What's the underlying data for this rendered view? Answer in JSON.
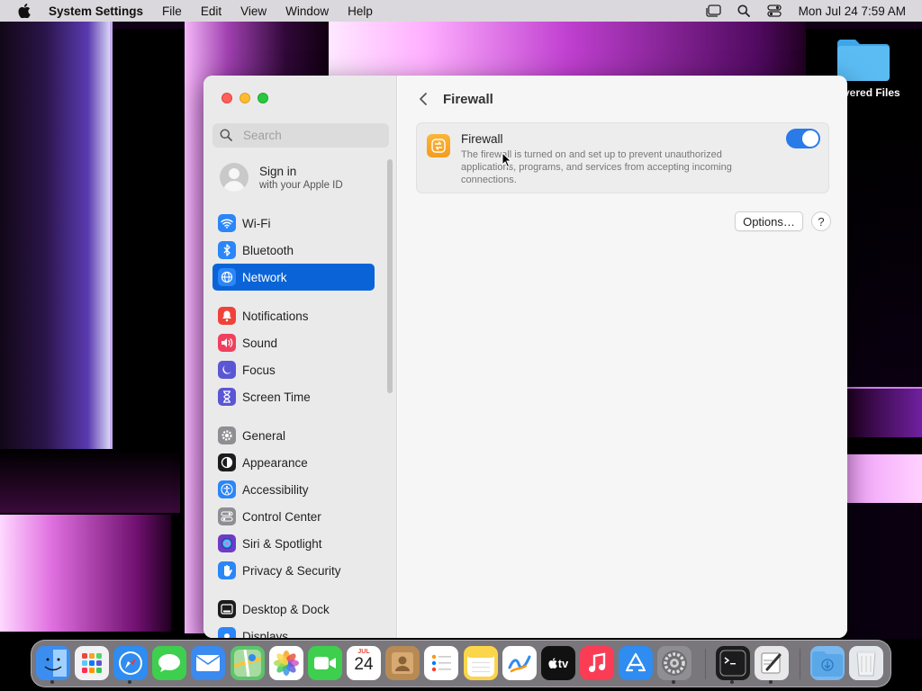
{
  "menubar": {
    "app_name": "System Settings",
    "menus": [
      "File",
      "Edit",
      "View",
      "Window",
      "Help"
    ],
    "clock": "Mon Jul 24  7:59 AM"
  },
  "desktop": {
    "folder_label": "vered Files"
  },
  "sidebar": {
    "search_placeholder": "Search",
    "signin_title": "Sign in",
    "signin_subtitle": "with your Apple ID",
    "items": [
      {
        "label": "Wi-Fi",
        "icon": "wifi-icon",
        "color": "#2b86f7"
      },
      {
        "label": "Bluetooth",
        "icon": "bluetooth-icon",
        "color": "#2b86f7"
      },
      {
        "label": "Network",
        "icon": "globe-icon",
        "color": "#2b86f7",
        "selected": true
      },
      {
        "label": "Notifications",
        "icon": "bell-icon",
        "color": "#f0423a"
      },
      {
        "label": "Sound",
        "icon": "speaker-icon",
        "color": "#f0405e"
      },
      {
        "label": "Focus",
        "icon": "moon-icon",
        "color": "#5a56d4"
      },
      {
        "label": "Screen Time",
        "icon": "hourglass-icon",
        "color": "#5a56d4"
      },
      {
        "label": "General",
        "icon": "gear-icon",
        "color": "#8e8e93"
      },
      {
        "label": "Appearance",
        "icon": "appearance-icon",
        "color": "#1c1c1e"
      },
      {
        "label": "Accessibility",
        "icon": "accessibility-icon",
        "color": "#2b86f7"
      },
      {
        "label": "Control Center",
        "icon": "control-center-icon",
        "color": "#8e8e93"
      },
      {
        "label": "Siri & Spotlight",
        "icon": "siri-icon",
        "color": "#6b3cc8"
      },
      {
        "label": "Privacy & Security",
        "icon": "hand-icon",
        "color": "#2b86f7"
      },
      {
        "label": "Desktop & Dock",
        "icon": "dock-icon",
        "color": "#1c1c1e"
      },
      {
        "label": "Displays",
        "icon": "sun-icon",
        "color": "#2b86f7"
      }
    ]
  },
  "content": {
    "title": "Firewall",
    "card": {
      "title": "Firewall",
      "description": "The firewall is turned on and set up to prevent unauthorized applications, programs, and services from accepting incoming connections.",
      "toggle_on": true
    },
    "options_label": "Options…",
    "help_label": "?"
  },
  "dock": {
    "calendar_month": "JUL",
    "calendar_day": "24",
    "tv_label": "tv",
    "items": [
      {
        "name": "finder-icon",
        "color": "#3b8ef0"
      },
      {
        "name": "launchpad-icon",
        "color": "#f2f2f4"
      },
      {
        "name": "safari-icon",
        "color": "#2f8cf0"
      },
      {
        "name": "messages-icon",
        "color": "#3ecf4e"
      },
      {
        "name": "mail-icon",
        "color": "#3a8af0"
      },
      {
        "name": "maps-icon",
        "color": "#5cc46c"
      },
      {
        "name": "photos-icon",
        "color": "#ffffff"
      },
      {
        "name": "facetime-icon",
        "color": "#3ecf4e"
      },
      {
        "name": "calendar-icon",
        "color": "#ffffff"
      },
      {
        "name": "contacts-icon",
        "color": "#b88a54"
      },
      {
        "name": "reminders-icon",
        "color": "#ffffff"
      },
      {
        "name": "notes-icon",
        "color": "#fbd54a"
      },
      {
        "name": "freeform-icon",
        "color": "#ffffff"
      },
      {
        "name": "apple-tv-icon",
        "color": "#111111"
      },
      {
        "name": "music-icon",
        "color": "#fa3c54"
      },
      {
        "name": "app-store-icon",
        "color": "#2f8cf0"
      },
      {
        "name": "system-settings-icon",
        "color": "#8e8e93"
      },
      {
        "name": "terminal-icon",
        "color": "#1c1c1e"
      },
      {
        "name": "script-editor-icon",
        "color": "#e8e8ea"
      },
      {
        "name": "downloads-folder-icon",
        "color": "#7ab8ef"
      },
      {
        "name": "trash-icon",
        "color": "#e4e8ec"
      }
    ]
  }
}
